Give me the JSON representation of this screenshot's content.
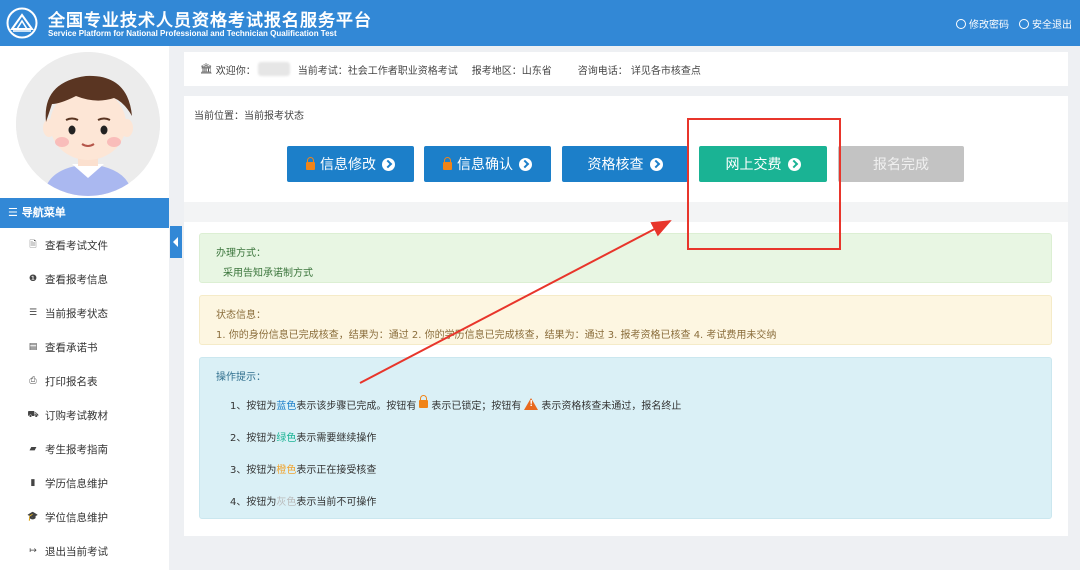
{
  "header": {
    "title_cn": "全国专业技术人员资格考试报名服务平台",
    "title_en": "Service Platform for National Professional and Technician Qualification Test",
    "change_password": "修改密码",
    "logout": "安全退出"
  },
  "sidebar": {
    "nav_title": "☰ 导航菜单",
    "items": [
      {
        "icon": "file-icon",
        "glyph": "🗎",
        "label": "查看考试文件"
      },
      {
        "icon": "info-icon",
        "glyph": "❶",
        "label": "查看报考信息"
      },
      {
        "icon": "list-icon",
        "glyph": "☰",
        "label": "当前报考状态"
      },
      {
        "icon": "id-card-icon",
        "glyph": "▤",
        "label": "查看承诺书"
      },
      {
        "icon": "print-icon",
        "glyph": "⎙",
        "label": "打印报名表"
      },
      {
        "icon": "cart-icon",
        "glyph": "⛟",
        "label": "订购考试教材"
      },
      {
        "icon": "book-icon",
        "glyph": "▰",
        "label": "考生报考指南"
      },
      {
        "icon": "document-icon",
        "glyph": "▮",
        "label": "学历信息维护"
      },
      {
        "icon": "graduation-cap-icon",
        "glyph": "🎓",
        "label": "学位信息维护"
      },
      {
        "icon": "sign-out-icon",
        "glyph": "↦",
        "label": "退出当前考试"
      }
    ]
  },
  "infobar": {
    "welcome": "欢迎你：",
    "exam": "当前考试：社会工作者职业资格考试",
    "region": "报考地区：山东省",
    "phone": "咨询电话：  详见各市核查点"
  },
  "main": {
    "position": "当前位置：当前报考状态",
    "steps": [
      {
        "label": "信息修改",
        "state": "blue",
        "locked": true
      },
      {
        "label": "信息确认",
        "state": "blue",
        "locked": true
      },
      {
        "label": "资格核查",
        "state": "blue",
        "locked": false
      },
      {
        "label": "网上交费",
        "state": "green",
        "locked": false
      },
      {
        "label": "报名完成",
        "state": "gray",
        "locked": false
      }
    ],
    "method": {
      "title": "办理方式：",
      "content": "采用告知承诺制方式"
    },
    "status": {
      "title": "状态信息：",
      "content": "1. 你的身份信息已完成核查，结果为：通过 2. 你的学历信息已完成核查，结果为：通过 3. 报考资格已核查 4. 考试费用未交纳"
    },
    "tips": {
      "title": "操作提示：",
      "t1_a": "1、按钮为",
      "t1_color": "蓝色",
      "t1_b": "表示该步骤已完成。按钮有",
      "t1_c": "表示已锁定；按钮有",
      "t1_d": "表示资格核查未通过，报名终止",
      "t2_a": "2、按钮为",
      "t2_color": "绿色",
      "t2_b": "表示需要继续操作",
      "t3_a": "3、按钮为",
      "t3_color": "橙色",
      "t3_b": "表示正在接受核查",
      "t4_a": "4、按钮为",
      "t4_color": "灰色",
      "t4_b": "表示当前不可操作"
    }
  },
  "colors": {
    "primary": "#3288d6",
    "step_blue": "#1c7fc9",
    "step_green": "#1ab394",
    "step_gray": "#c3c3c3",
    "annotation": "#e8352b"
  }
}
